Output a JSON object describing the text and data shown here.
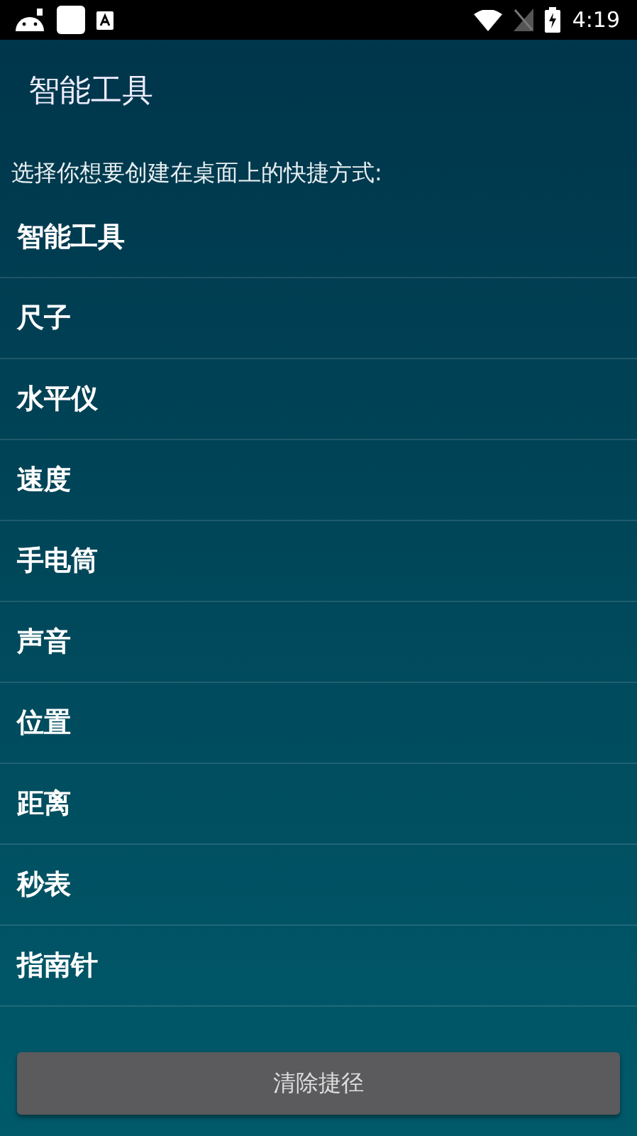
{
  "status_bar": {
    "time": "4:19"
  },
  "app_bar": {
    "title": "智能工具"
  },
  "prompt": "选择你想要创建在桌面上的快捷方式:",
  "items": [
    {
      "label": "智能工具"
    },
    {
      "label": "尺子"
    },
    {
      "label": "水平仪"
    },
    {
      "label": "速度"
    },
    {
      "label": "手电筒"
    },
    {
      "label": "声音"
    },
    {
      "label": "位置"
    },
    {
      "label": "距离"
    },
    {
      "label": "秒表"
    },
    {
      "label": "指南针"
    }
  ],
  "button": {
    "label": "清除捷径"
  }
}
